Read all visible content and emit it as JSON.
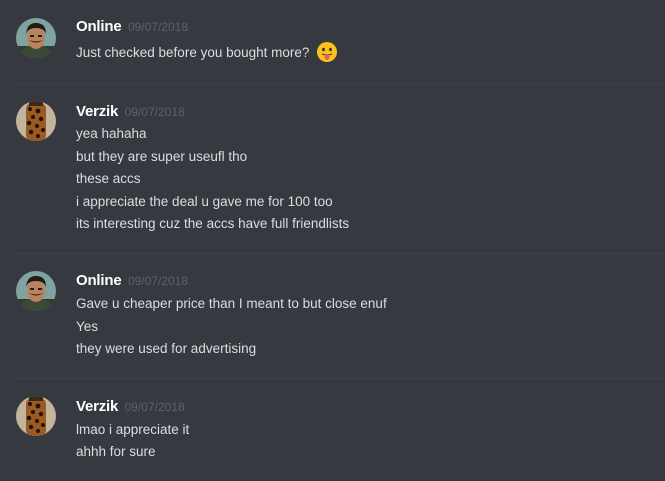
{
  "messages": [
    {
      "author": "Online",
      "timestamp": "09/07/2018",
      "avatar": "man-with-mustache-avatar",
      "lines": [
        "Just checked before you bought more?"
      ],
      "emoji": "tongue-out-emoji"
    },
    {
      "author": "Verzik",
      "timestamp": "09/07/2018",
      "avatar": "leopard-pattern-avatar",
      "lines": [
        "yea hahaha",
        "but they are super useufl tho",
        "these accs",
        "i appreciate the deal u gave me for 100 too",
        "its interesting cuz the accs have full friendlists"
      ]
    },
    {
      "author": "Online",
      "timestamp": "09/07/2018",
      "avatar": "man-with-mustache-avatar",
      "lines": [
        "Gave u cheaper price than I meant to but close enuf",
        "Yes",
        "they were used for advertising"
      ]
    },
    {
      "author": "Verzik",
      "timestamp": "09/07/2018",
      "avatar": "leopard-pattern-avatar",
      "lines": [
        "lmao i appreciate it",
        "ahhh for sure"
      ]
    }
  ],
  "colors": {
    "background": "#36393f",
    "username": "#ffffff",
    "timestamp": "#5e6167",
    "text": "#dcddde",
    "divider": "#3f4248"
  }
}
